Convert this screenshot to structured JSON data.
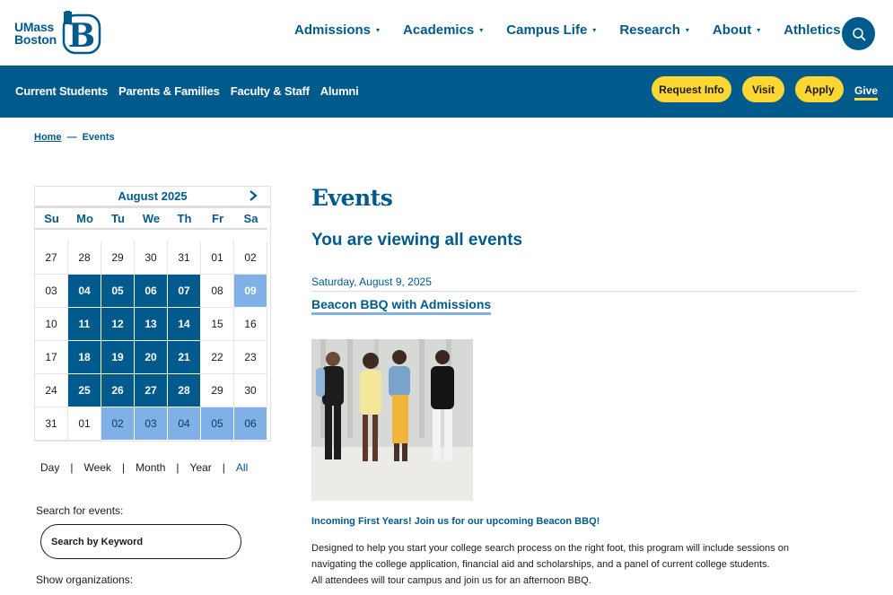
{
  "header": {
    "logo_line1": "UMass",
    "logo_line2": "Boston",
    "logo_letter": "B",
    "nav": [
      "Admissions",
      "Academics",
      "Campus Life",
      "Research",
      "About",
      "Athletics"
    ],
    "search_icon": "search-icon"
  },
  "bluebar": {
    "audience": [
      "Current Students",
      "Parents & Families",
      "Faculty & Staff",
      "Alumni"
    ],
    "request_info": "Request Info",
    "visit": "Visit",
    "apply": "Apply",
    "give": "Give",
    "cta_color": "#fcd733",
    "brand_color": "#005a8b"
  },
  "breadcrumb": {
    "home": "Home",
    "separator": "—",
    "current": "Events"
  },
  "calendar": {
    "month": "August 2025",
    "next_icon": "chevron-right-icon",
    "weekdays": [
      "Su",
      "Mo",
      "Tu",
      "We",
      "Th",
      "Fr",
      "Sa"
    ],
    "weeks": [
      [
        {
          "d": "27",
          "s": ""
        },
        {
          "d": "28",
          "s": ""
        },
        {
          "d": "29",
          "s": ""
        },
        {
          "d": "30",
          "s": ""
        },
        {
          "d": "31",
          "s": ""
        },
        {
          "d": "01",
          "s": ""
        },
        {
          "d": "02",
          "s": ""
        }
      ],
      [
        {
          "d": "03",
          "s": ""
        },
        {
          "d": "04",
          "s": "ev"
        },
        {
          "d": "05",
          "s": "ev"
        },
        {
          "d": "06",
          "s": "ev"
        },
        {
          "d": "07",
          "s": "ev"
        },
        {
          "d": "08",
          "s": ""
        },
        {
          "d": "09",
          "s": "sel"
        }
      ],
      [
        {
          "d": "10",
          "s": ""
        },
        {
          "d": "11",
          "s": "ev"
        },
        {
          "d": "12",
          "s": "ev"
        },
        {
          "d": "13",
          "s": "ev"
        },
        {
          "d": "14",
          "s": "ev"
        },
        {
          "d": "15",
          "s": ""
        },
        {
          "d": "16",
          "s": ""
        }
      ],
      [
        {
          "d": "17",
          "s": ""
        },
        {
          "d": "18",
          "s": "ev"
        },
        {
          "d": "19",
          "s": "ev"
        },
        {
          "d": "20",
          "s": "ev"
        },
        {
          "d": "21",
          "s": "ev"
        },
        {
          "d": "22",
          "s": ""
        },
        {
          "d": "23",
          "s": ""
        }
      ],
      [
        {
          "d": "24",
          "s": ""
        },
        {
          "d": "25",
          "s": "ev"
        },
        {
          "d": "26",
          "s": "ev"
        },
        {
          "d": "27",
          "s": "ev"
        },
        {
          "d": "28",
          "s": "ev"
        },
        {
          "d": "29",
          "s": ""
        },
        {
          "d": "30",
          "s": ""
        }
      ],
      [
        {
          "d": "31",
          "s": ""
        },
        {
          "d": "01",
          "s": ""
        },
        {
          "d": "02",
          "s": "lt"
        },
        {
          "d": "03",
          "s": "lt"
        },
        {
          "d": "04",
          "s": "lt"
        },
        {
          "d": "05",
          "s": "lt"
        },
        {
          "d": "06",
          "s": "lt"
        }
      ]
    ]
  },
  "views": {
    "day": "Day",
    "week": "Week",
    "month": "Month",
    "year": "Year",
    "all": "All",
    "separator": "|"
  },
  "search": {
    "label": "Search for events:",
    "placeholder": "Search by Keyword",
    "orgs_label": "Show organizations:"
  },
  "main": {
    "title": "Events",
    "subtitle": "You are viewing all events",
    "event": {
      "date": "Saturday, August 9, 2025",
      "title": "Beacon BBQ with Admissions",
      "tagline": "Incoming First Years! Join us for our upcoming Beacon BBQ!",
      "desc_line1": "Designed to help you start your college search process on the right foot, this program will include sessions on",
      "desc_line2": "navigating the college application, financial aid and scholarships, and a panel of current college students.",
      "desc_line3": "All attendees will tour campus and join us for an afternoon BBQ."
    }
  }
}
